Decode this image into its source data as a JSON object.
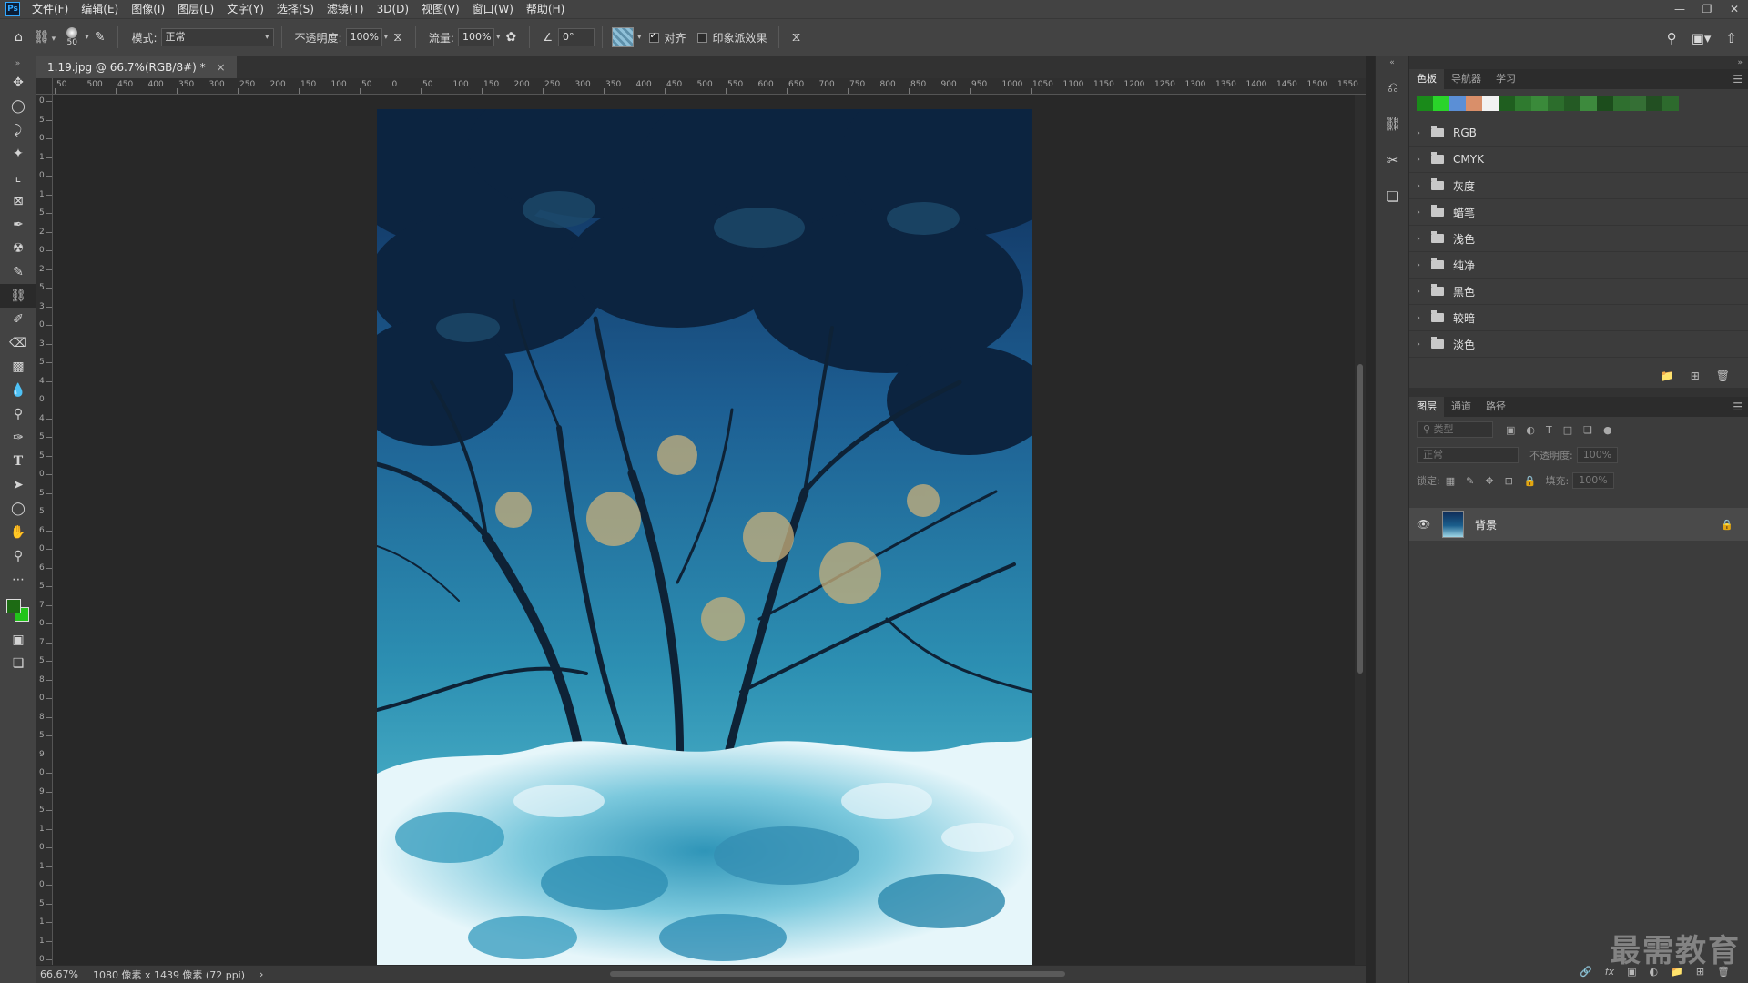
{
  "menubar": {
    "logo": "Ps",
    "items": [
      "文件(F)",
      "编辑(E)",
      "图像(I)",
      "图层(L)",
      "文字(Y)",
      "选择(S)",
      "滤镜(T)",
      "3D(D)",
      "视图(V)",
      "窗口(W)",
      "帮助(H)"
    ]
  },
  "options": {
    "brush_size": "50",
    "mode_label": "模式:",
    "mode_value": "正常",
    "opacity_label": "不透明度:",
    "opacity_value": "100%",
    "flow_label": "流量:",
    "flow_value": "100%",
    "angle_value": "0°",
    "align_label": "对齐",
    "align_checked": true,
    "impressionist_label": "印象派效果",
    "impressionist_checked": false
  },
  "document": {
    "tab_title": "1.19.jpg @ 66.7%(RGB/8#) *",
    "zoom": "66.67%",
    "doc_info": "1080 像素 x 1439 像素 (72 ppi)"
  },
  "ruler": {
    "top_labels": [
      "50",
      "500",
      "450",
      "400",
      "350",
      "300",
      "250",
      "200",
      "150",
      "100",
      "50",
      "0",
      "50",
      "100",
      "150",
      "200",
      "250",
      "300",
      "350",
      "400",
      "450",
      "500",
      "550",
      "600",
      "650",
      "700",
      "750",
      "800",
      "850",
      "900",
      "950",
      "1000",
      "1050",
      "1100",
      "1150",
      "1200",
      "1250",
      "1300",
      "1350",
      "1400",
      "1450",
      "1500",
      "1550"
    ],
    "left_labels": [
      "0",
      "5",
      "0",
      "1",
      "0",
      "1",
      "5",
      "2",
      "0",
      "2",
      "5",
      "3",
      "0",
      "3",
      "5",
      "4",
      "0",
      "4",
      "5",
      "5",
      "0",
      "5",
      "5",
      "6",
      "0",
      "6",
      "5",
      "7",
      "0",
      "7",
      "5",
      "8",
      "0",
      "8",
      "5",
      "9",
      "0",
      "9",
      "5",
      "1",
      "0",
      "1",
      "0",
      "5",
      "1",
      "1",
      "0"
    ]
  },
  "colors": {
    "foreground": "#1d6b14",
    "background": "#22c41a",
    "accent": "#31a8ff"
  },
  "swatches": {
    "tabs": [
      "色板",
      "导航器",
      "学习"
    ],
    "strip": [
      "#1a8a1a",
      "#2ad42a",
      "#5b8fd6",
      "#d98f6a",
      "#f2f2f2",
      "#1f5e1f",
      "#2f7a2f",
      "#3a8a3a",
      "#2c6d2c",
      "#245a24",
      "#3d8a3d",
      "#1c4d1c",
      "#2f6f2f",
      "#356f35",
      "#224f22",
      "#2d6a2d"
    ],
    "groups": [
      "RGB",
      "CMYK",
      "灰度",
      "蜡笔",
      "浅色",
      "纯净",
      "黑色",
      "较暗",
      "淡色"
    ]
  },
  "layers": {
    "tabs": [
      "图层",
      "通道",
      "路径"
    ],
    "filter_placeholder": "类型",
    "blend_mode": "正常",
    "opacity_label": "不透明度:",
    "opacity_value": "100%",
    "lock_label": "锁定:",
    "fill_label": "填充:",
    "fill_value": "100%",
    "items": [
      {
        "name": "背景",
        "visible": true,
        "locked": true
      }
    ]
  },
  "watermark": "最需教育"
}
